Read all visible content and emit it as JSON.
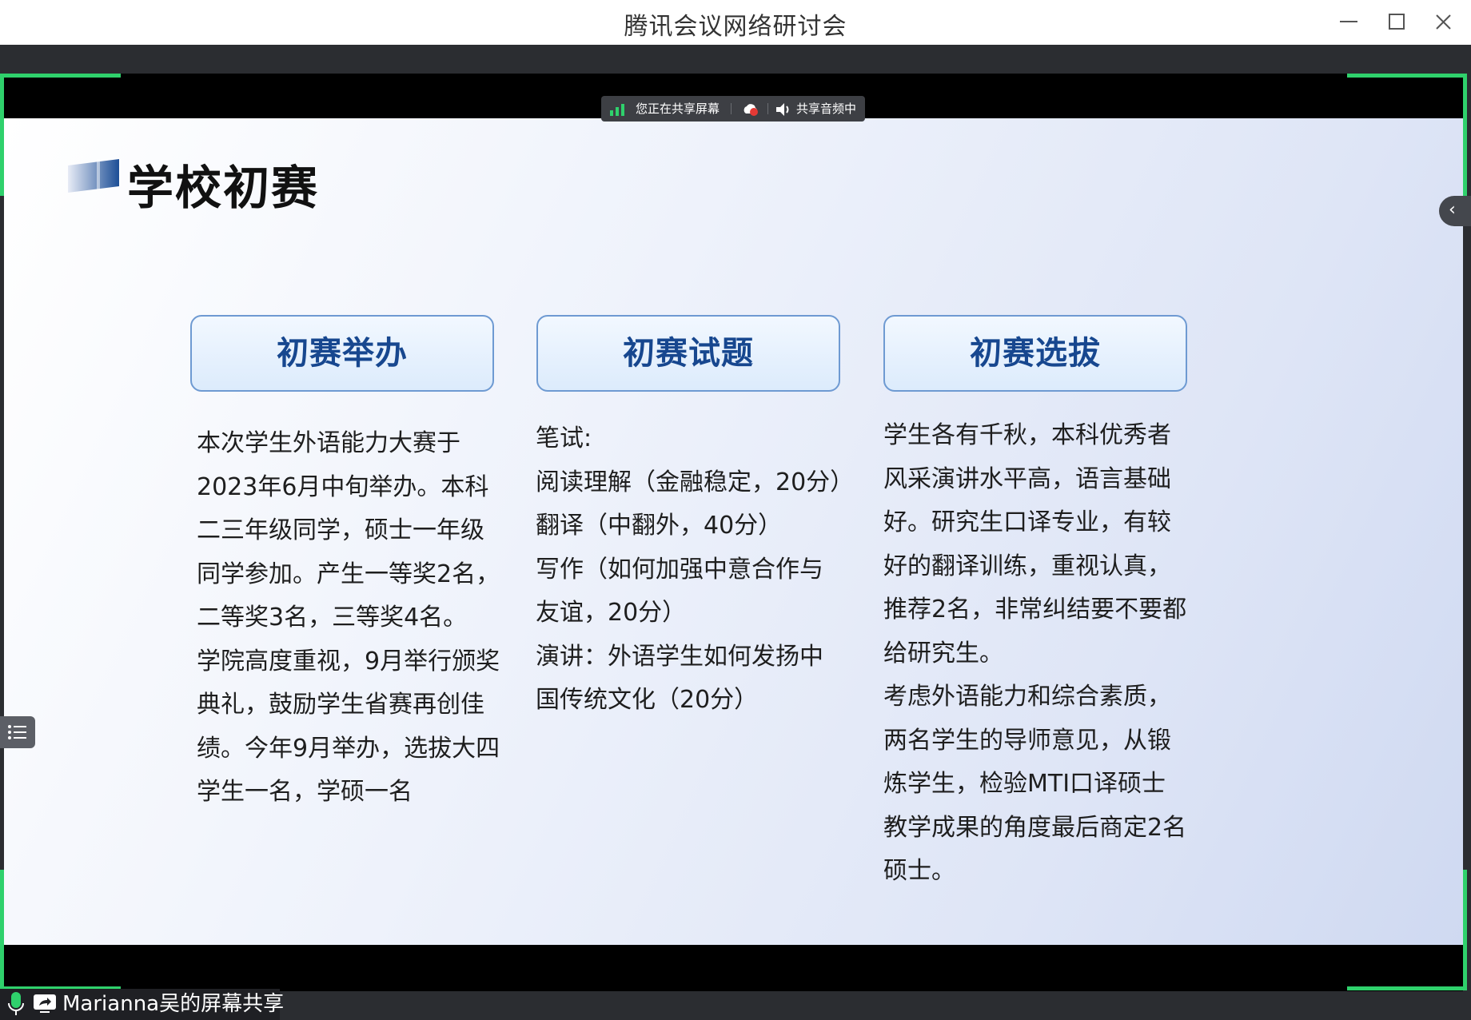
{
  "window": {
    "title": "腾讯会议网络研讨会"
  },
  "share_bar": {
    "sharing_label": "您正在共享屏幕",
    "audio_label": "共享音频中"
  },
  "slide": {
    "title": "学校初赛",
    "columns": [
      {
        "heading": "初赛举办",
        "lines": [
          "本次学生外语能力大赛于",
          "2023年6月中旬举办。本科",
          "二三年级同学，硕士一年级",
          "同学参加。产生一等奖2名，",
          "二等奖3名，三等奖4名。",
          "学院高度重视，9月举行颁奖",
          "典礼，鼓励学生省赛再创佳",
          "绩。今年9月举办，选拔大四",
          "学生一名，学硕一名"
        ]
      },
      {
        "heading": "初赛试题",
        "lines": [
          "笔试:",
          "阅读理解（金融稳定，20分）",
          "翻译（中翻外，40分）",
          "写作（如何加强中意合作与",
          "友谊，20分）",
          "演讲：外语学生如何发扬中",
          "国传统文化（20分）"
        ]
      },
      {
        "heading": "初赛选拔",
        "lines": [
          "学生各有千秋，本科优秀者",
          "风采演讲水平高，语言基础",
          "好。研究生口译专业，有较",
          "好的翻译训练，重视认真，",
          "推荐2名，非常纠结要不要都",
          "给研究生。",
          "考虑外语能力和综合素质，",
          "两名学生的导师意见，从锻",
          "炼学生，检验MTI口译硕士",
          "教学成果的角度最后商定2名",
          "硕士。"
        ]
      }
    ]
  },
  "status": {
    "presenter_label": "Marianna吴的屏幕共享"
  },
  "colors": {
    "share_frame": "#2fd16c",
    "heading_text": "#17478f",
    "heading_border": "#6e9ad2"
  },
  "icons": {
    "minimize": "minimize-icon",
    "maximize": "maximize-icon",
    "close": "close-icon",
    "signal": "signal-icon",
    "recording": "cloud-record-icon",
    "speaker": "speaker-icon",
    "collapse": "chevron-left-icon",
    "list": "list-icon",
    "mic": "microphone-icon",
    "screen_share": "screen-share-icon"
  }
}
